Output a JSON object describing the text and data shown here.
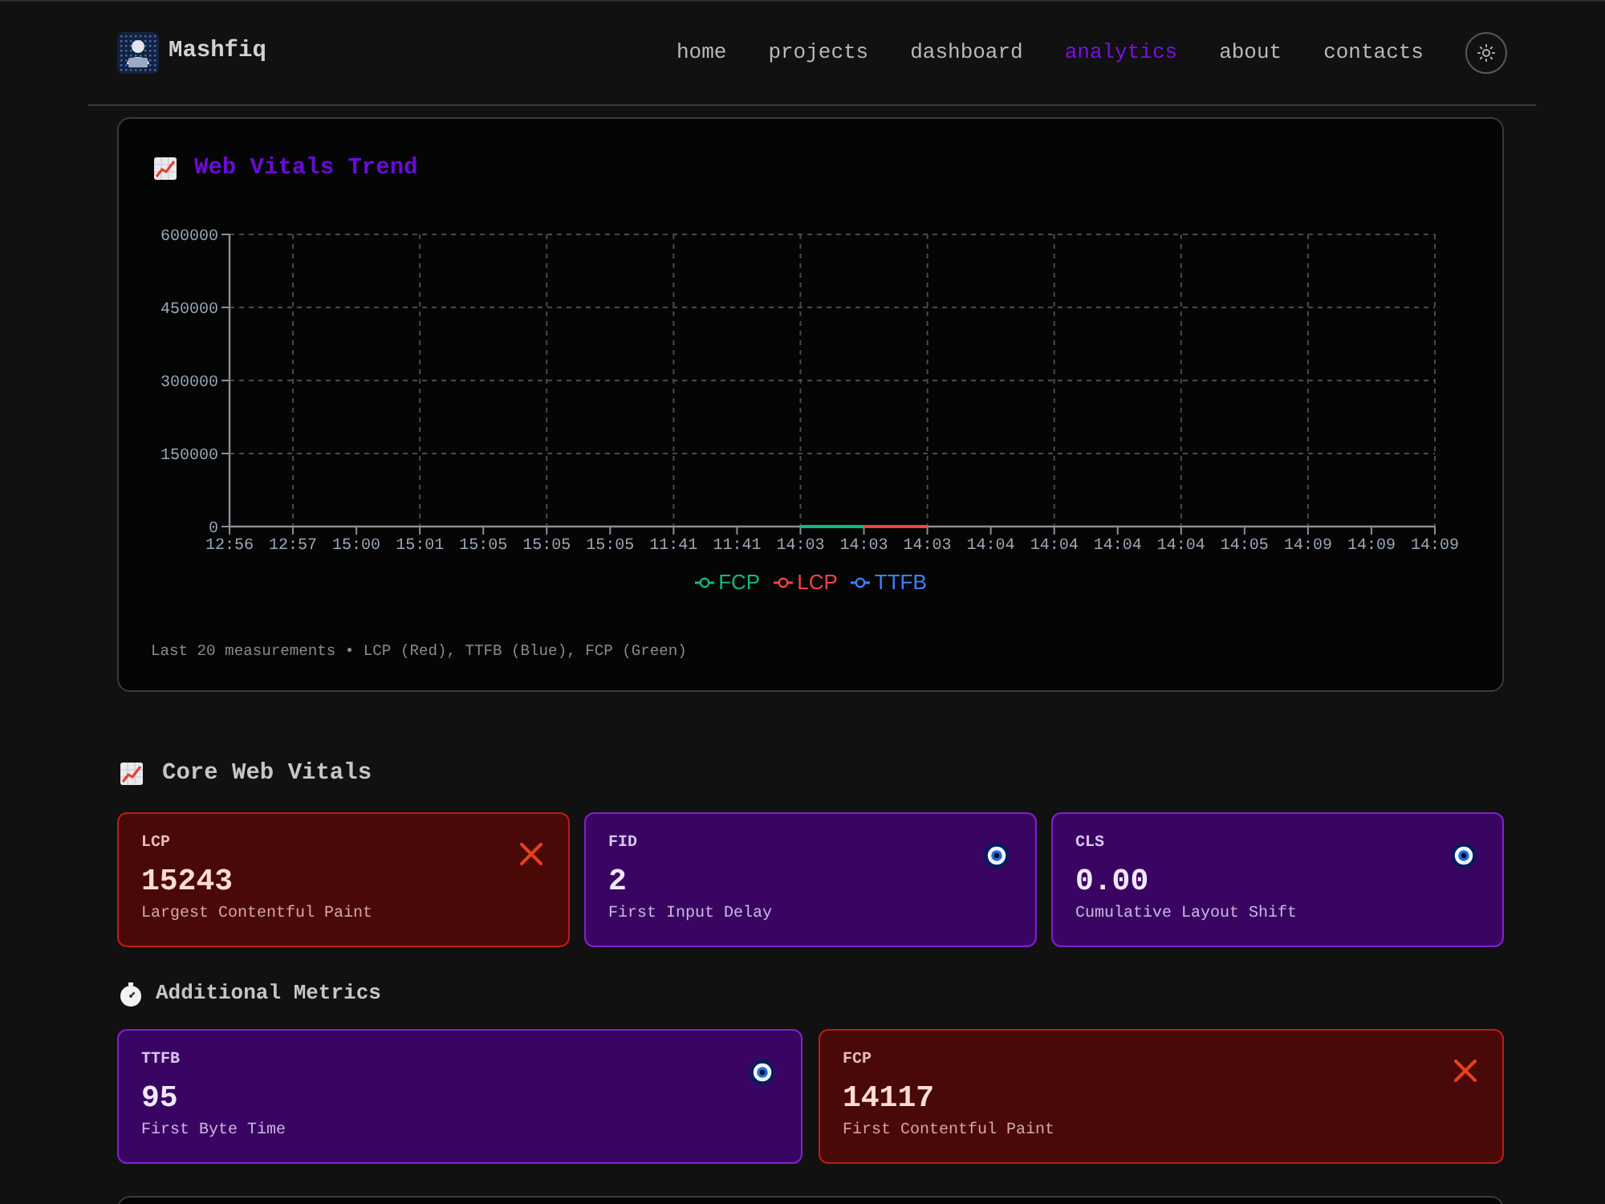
{
  "header": {
    "brand": "Mashfiq",
    "nav": [
      {
        "label": "home",
        "selected": false
      },
      {
        "label": "projects",
        "selected": false
      },
      {
        "label": "dashboard",
        "selected": false
      },
      {
        "label": "analytics",
        "selected": true
      },
      {
        "label": "about",
        "selected": false
      },
      {
        "label": "contacts",
        "selected": false
      }
    ]
  },
  "trend_card": {
    "title": "Web Vitals Trend",
    "chart_data": {
      "type": "line",
      "categories": [
        "12:56",
        "12:57",
        "15:00",
        "15:01",
        "15:05",
        "15:05",
        "15:05",
        "11:41",
        "11:41",
        "14:03",
        "14:03",
        "14:03",
        "14:04",
        "14:04",
        "14:04",
        "14:04",
        "14:05",
        "14:09",
        "14:09",
        "14:09"
      ],
      "series": [
        {
          "name": "FCP",
          "color": "#10b981",
          "values": [
            null,
            null,
            null,
            null,
            null,
            null,
            null,
            null,
            null,
            0,
            0,
            null,
            null,
            null,
            null,
            null,
            null,
            null,
            null,
            null
          ]
        },
        {
          "name": "LCP",
          "color": "#ef4444",
          "values": [
            null,
            null,
            null,
            null,
            null,
            null,
            null,
            null,
            null,
            null,
            0,
            0,
            null,
            null,
            null,
            null,
            null,
            null,
            null,
            null
          ]
        },
        {
          "name": "TTFB",
          "color": "#3b82f6",
          "values": [
            null,
            null,
            null,
            null,
            null,
            null,
            null,
            null,
            null,
            null,
            null,
            null,
            null,
            null,
            null,
            null,
            null,
            null,
            null,
            null
          ]
        }
      ],
      "ylim": [
        0,
        600000
      ],
      "yticks": [
        0,
        150000,
        300000,
        450000,
        600000
      ],
      "grid": true,
      "legend": "bottom"
    },
    "note": "Last 20 measurements • LCP (Red), TTFB (Blue), FCP (Green)"
  },
  "core_vitals": {
    "title": "Core Web Vitals",
    "metrics": [
      {
        "label": "LCP",
        "value": "15243",
        "description": "Largest Contentful Paint",
        "kind": "poor"
      },
      {
        "label": "FID",
        "value": "2",
        "description": "First Input Delay",
        "kind": "good"
      },
      {
        "label": "CLS",
        "value": "0.00",
        "description": "Cumulative Layout Shift",
        "kind": "good"
      }
    ]
  },
  "additional_metrics": {
    "title": "Additional Metrics",
    "metrics": [
      {
        "label": "TTFB",
        "value": "95",
        "description": "First Byte Time",
        "kind": "good"
      },
      {
        "label": "FCP",
        "value": "14117",
        "description": "First Contentful Paint",
        "kind": "poor"
      }
    ]
  }
}
